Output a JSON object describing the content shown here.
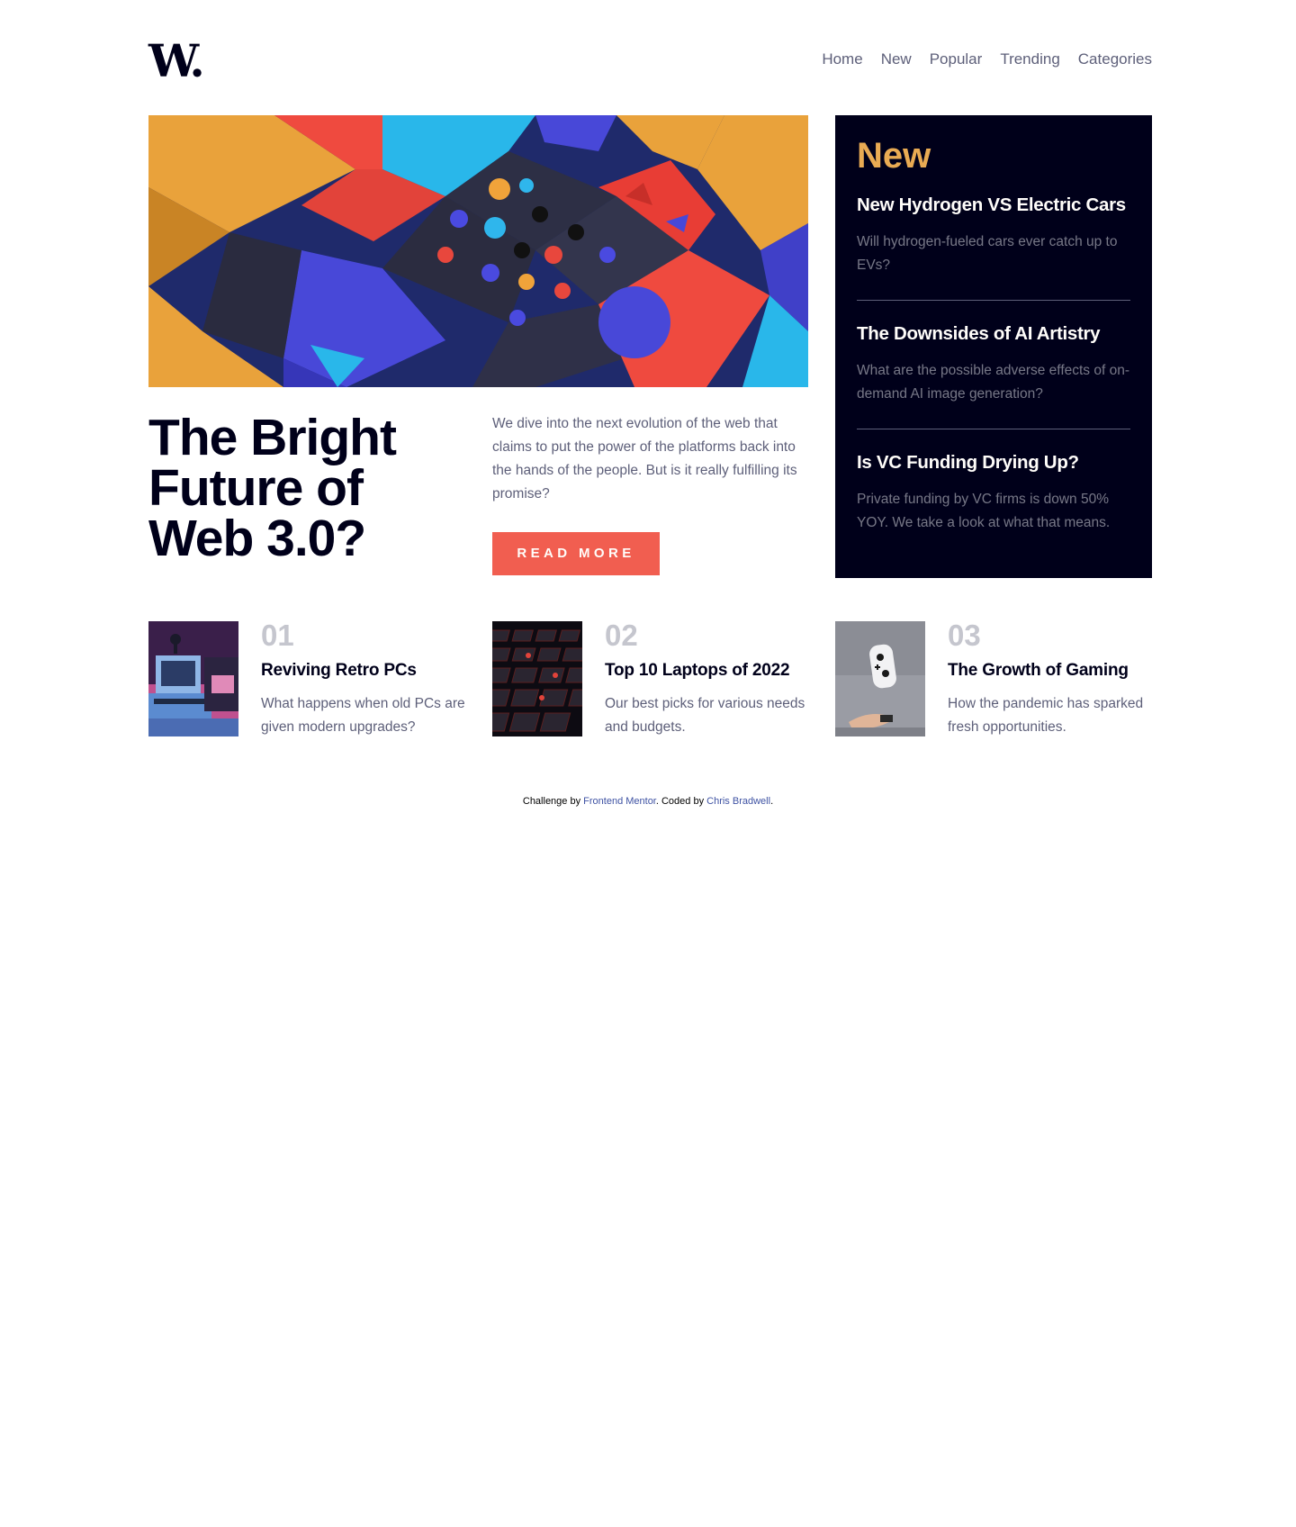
{
  "header": {
    "logo": "W.",
    "nav": [
      "Home",
      "New",
      "Popular",
      "Trending",
      "Categories"
    ]
  },
  "hero": {
    "title": "The Bright Future of Web 3.0?",
    "description": "We dive into the next evolution of the web that claims to put the power of the platforms back into the hands of the people. But is it really fulfilling its promise?",
    "button_label": "READ MORE"
  },
  "new_panel": {
    "heading": "New",
    "items": [
      {
        "title": "New Hydrogen VS Electric Cars",
        "description": "Will hydrogen-fueled cars ever catch up to EVs?"
      },
      {
        "title": "The Downsides of AI Artistry",
        "description": "What are the possible adverse effects of on-demand AI image generation?"
      },
      {
        "title": "Is VC Funding Drying Up?",
        "description": "Private funding by VC firms is down 50% YOY. We take a look at what that means."
      }
    ]
  },
  "cards": [
    {
      "number": "01",
      "title": "Reviving Retro PCs",
      "description": "What happens when old PCs are given modern upgrades?"
    },
    {
      "number": "02",
      "title": "Top 10 Laptops of 2022",
      "description": "Our best picks for various needs and budgets."
    },
    {
      "number": "03",
      "title": "The Growth of Gaming",
      "description": "How the pandemic has sparked fresh opportunities."
    }
  ],
  "footer": {
    "prefix": "Challenge by ",
    "link1": "Frontend Mentor",
    "middle": ". Coded by ",
    "link2": "Chris Bradwell",
    "suffix": "."
  },
  "colors": {
    "soft_red": "#f15e50",
    "soft_orange": "#e9ab53",
    "very_dark_blue": "#00001a",
    "grayish_blue": "#c5c6ce",
    "dark_grayish_blue": "#5d5f79"
  }
}
